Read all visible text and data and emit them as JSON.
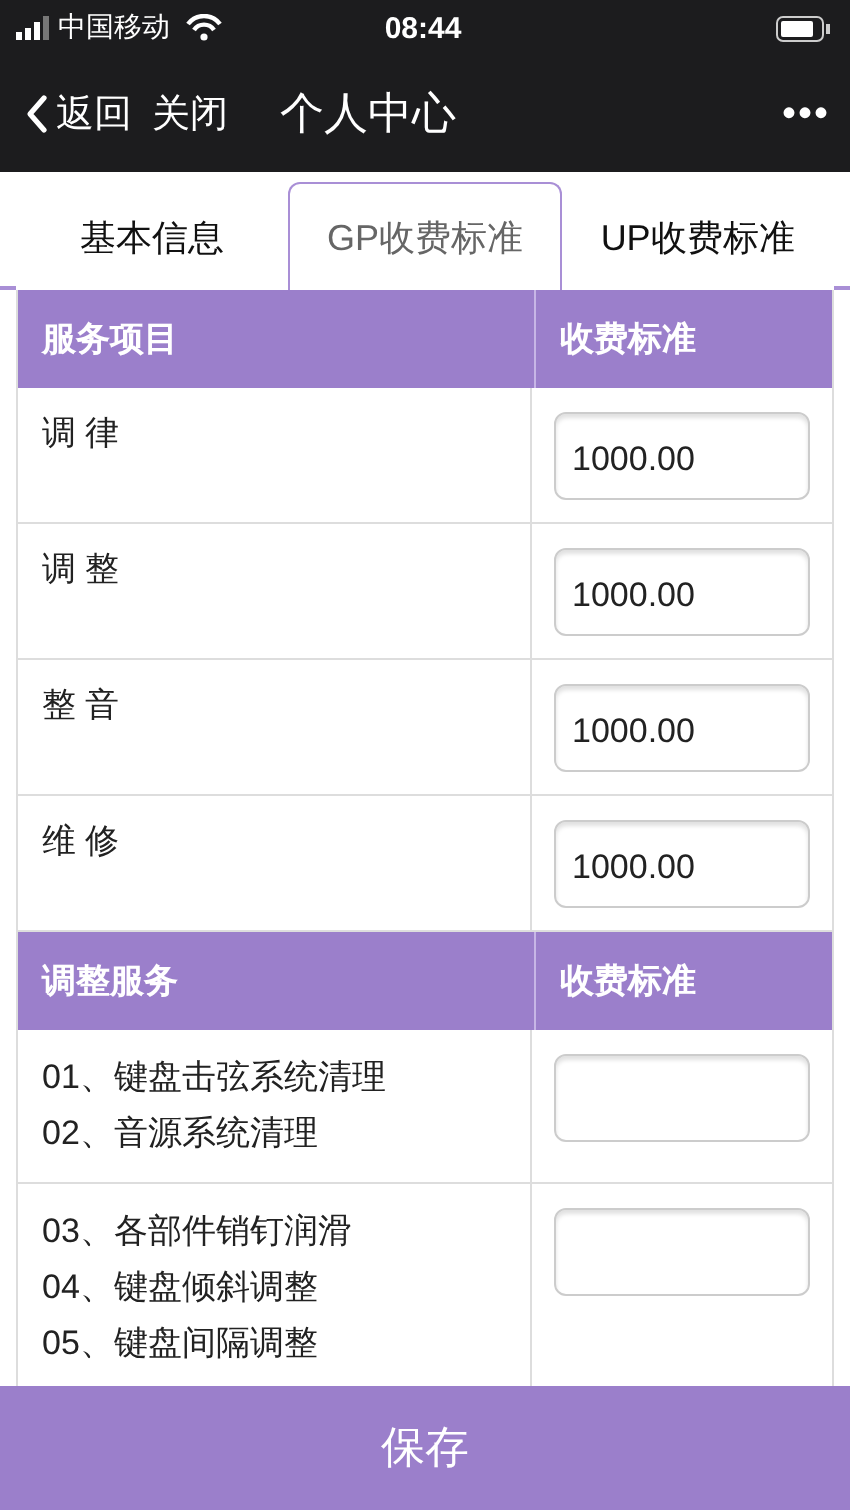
{
  "status_bar": {
    "carrier": "中国移动",
    "time": "08:44"
  },
  "nav": {
    "back": "返回",
    "close": "关闭",
    "title": "个人中心",
    "more": "•••"
  },
  "tabs": [
    {
      "label": "基本信息",
      "selected": false
    },
    {
      "label": "GP收费标准",
      "selected": true
    },
    {
      "label": "UP收费标准",
      "selected": false
    }
  ],
  "sections": [
    {
      "header": {
        "item": "服务项目",
        "fee": "收费标准"
      },
      "rows": [
        {
          "lines": [
            "调 律"
          ],
          "value": "1000.00"
        },
        {
          "lines": [
            "调 整"
          ],
          "value": "1000.00"
        },
        {
          "lines": [
            "整 音"
          ],
          "value": "1000.00"
        },
        {
          "lines": [
            "维 修"
          ],
          "value": "1000.00"
        }
      ]
    },
    {
      "header": {
        "item": "调整服务",
        "fee": "收费标准"
      },
      "rows": [
        {
          "lines": [
            "01、键盘击弦系统清理",
            "02、音源系统清理"
          ]
        },
        {
          "lines": [
            "03、各部件销钉润滑",
            "04、键盘倾斜调整",
            "05、键盘间隔调整"
          ]
        }
      ]
    }
  ],
  "save_button": "保存"
}
